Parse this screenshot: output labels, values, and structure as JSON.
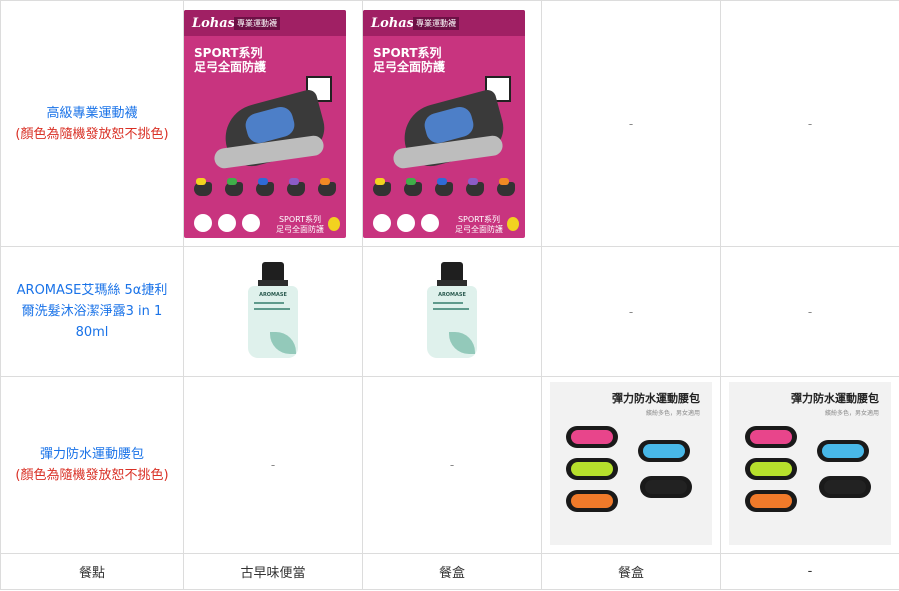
{
  "rows": [
    {
      "label": "高級專業運動襪",
      "note": "(顏色為隨機發放恕不挑色)",
      "cells": [
        "image",
        "image",
        "-",
        "-"
      ],
      "image": {
        "brand": "Lohas",
        "tag": "專業運動襪",
        "title_line1": "SPORT系列",
        "title_line2": "足弓全面防護",
        "bottom_title_line1": "SPORT系列",
        "bottom_title_line2": "足弓全面防護",
        "mini_colors": [
          "#f2d21f",
          "#3fae49",
          "#2f6bd6",
          "#8b5cc7",
          "#f08a24"
        ]
      }
    },
    {
      "label": "AROMASE艾瑪絲 5α捷利爾洗髮沐浴潔淨露3 in 1 80ml",
      "note": "",
      "cells": [
        "image",
        "image",
        "-",
        "-"
      ],
      "image": {
        "brand": "AROMASE"
      }
    },
    {
      "label": "彈力防水運動腰包",
      "note": "(顏色為隨機發放恕不挑色)",
      "cells": [
        "-",
        "-",
        "image",
        "image"
      ],
      "image": {
        "title": "彈力防水運動腰包",
        "subtitle": "繽紛多色，男女適用",
        "bag_colors": [
          "#e8458b",
          "#48b8e8",
          "#b6e02c",
          "#222222",
          "#f07a2a"
        ]
      }
    }
  ],
  "footer": [
    "餐點",
    "古早味便當",
    "餐盒",
    "餐盒",
    "-"
  ]
}
